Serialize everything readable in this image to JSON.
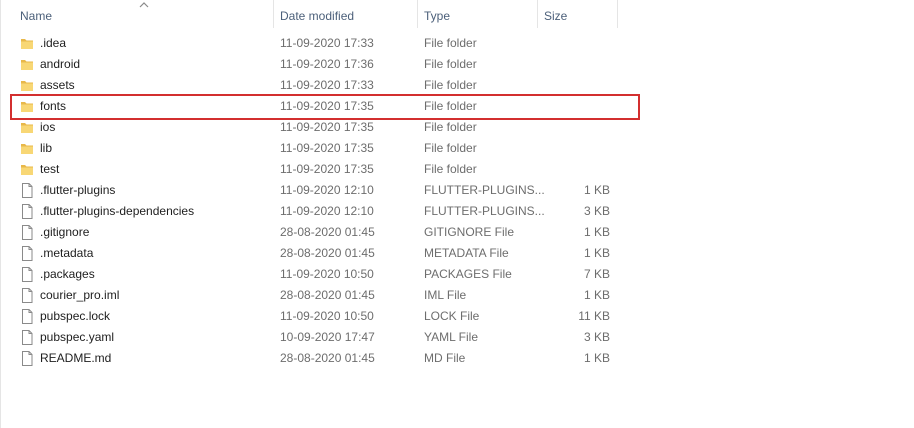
{
  "columns": {
    "name": "Name",
    "date_modified": "Date modified",
    "type": "Type",
    "size": "Size"
  },
  "files": [
    {
      "name": ".idea",
      "date": "11-09-2020 17:33",
      "type": "File folder",
      "size": "",
      "kind": "folder-icon"
    },
    {
      "name": "android",
      "date": "11-09-2020 17:36",
      "type": "File folder",
      "size": "",
      "kind": "folder-icon"
    },
    {
      "name": "assets",
      "date": "11-09-2020 17:33",
      "type": "File folder",
      "size": "",
      "kind": "folder-icon"
    },
    {
      "name": "fonts",
      "date": "11-09-2020 17:35",
      "type": "File folder",
      "size": "",
      "kind": "folder-icon"
    },
    {
      "name": "ios",
      "date": "11-09-2020 17:35",
      "type": "File folder",
      "size": "",
      "kind": "folder-icon"
    },
    {
      "name": "lib",
      "date": "11-09-2020 17:35",
      "type": "File folder",
      "size": "",
      "kind": "folder-icon"
    },
    {
      "name": "test",
      "date": "11-09-2020 17:35",
      "type": "File folder",
      "size": "",
      "kind": "folder-icon"
    },
    {
      "name": ".flutter-plugins",
      "date": "11-09-2020 12:10",
      "type": "FLUTTER-PLUGINS...",
      "size": "1 KB",
      "kind": "file-icon"
    },
    {
      "name": ".flutter-plugins-dependencies",
      "date": "11-09-2020 12:10",
      "type": "FLUTTER-PLUGINS...",
      "size": "3 KB",
      "kind": "file-icon"
    },
    {
      "name": ".gitignore",
      "date": "28-08-2020 01:45",
      "type": "GITIGNORE File",
      "size": "1 KB",
      "kind": "file-icon"
    },
    {
      "name": ".metadata",
      "date": "28-08-2020 01:45",
      "type": "METADATA File",
      "size": "1 KB",
      "kind": "file-icon"
    },
    {
      "name": ".packages",
      "date": "11-09-2020 10:50",
      "type": "PACKAGES File",
      "size": "7 KB",
      "kind": "file-icon"
    },
    {
      "name": "courier_pro.iml",
      "date": "28-08-2020 01:45",
      "type": "IML File",
      "size": "1 KB",
      "kind": "file-icon"
    },
    {
      "name": "pubspec.lock",
      "date": "11-09-2020 10:50",
      "type": "LOCK File",
      "size": "11 KB",
      "kind": "file-icon"
    },
    {
      "name": "pubspec.yaml",
      "date": "10-09-2020 17:47",
      "type": "YAML File",
      "size": "3 KB",
      "kind": "file-icon"
    },
    {
      "name": "README.md",
      "date": "28-08-2020 01:45",
      "type": "MD File",
      "size": "1 KB",
      "kind": "file-icon"
    }
  ],
  "highlighted_item": "fonts",
  "colors": {
    "folder": "#f8d775",
    "highlight_border": "#d32f2f",
    "header_text": "#4c607a"
  }
}
